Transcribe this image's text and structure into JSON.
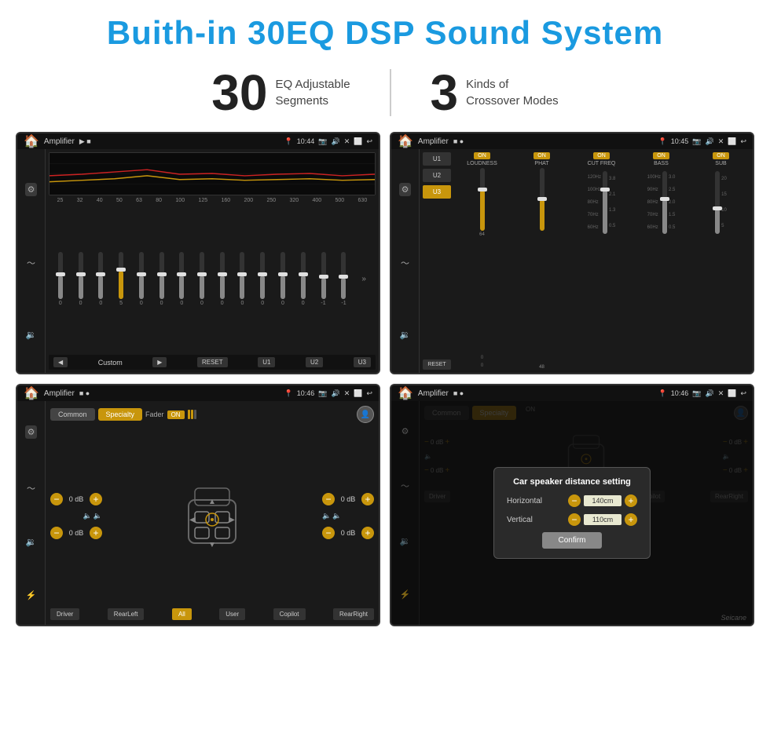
{
  "header": {
    "title": "Buith-in 30EQ DSP Sound System",
    "title_color": "#1a9ae0"
  },
  "stats": [
    {
      "number": "30",
      "label": "EQ Adjustable\nSegments"
    },
    {
      "number": "3",
      "label": "Kinds of\nCrossover Modes"
    }
  ],
  "screens": {
    "top_left": {
      "title": "Amplifier",
      "time": "10:44",
      "eq_labels": [
        "25",
        "32",
        "40",
        "50",
        "63",
        "80",
        "100",
        "125",
        "160",
        "200",
        "250",
        "320",
        "400",
        "500",
        "630"
      ],
      "eq_values": [
        "0",
        "0",
        "0",
        "5",
        "0",
        "0",
        "0",
        "0",
        "0",
        "0",
        "0",
        "0",
        "0",
        "-1",
        "0",
        "-1"
      ],
      "bottom_btns": [
        "Custom",
        "RESET",
        "U1",
        "U2",
        "U3"
      ]
    },
    "top_right": {
      "title": "Amplifier",
      "time": "10:45",
      "presets": [
        "U1",
        "U2",
        "U3"
      ],
      "channels": [
        "LOUDNESS",
        "PHAT",
        "CUT FREQ",
        "BASS",
        "SUB"
      ],
      "on_label": "ON",
      "reset_label": "RESET"
    },
    "bottom_left": {
      "title": "Amplifier",
      "time": "10:46",
      "mode_btns": [
        "Common",
        "Specialty"
      ],
      "active_mode": "Specialty",
      "fader_label": "Fader",
      "on_label": "ON",
      "db_values": [
        "0 dB",
        "0 dB",
        "0 dB",
        "0 dB"
      ],
      "speaker_btns": [
        "Driver",
        "RearLeft",
        "All",
        "User",
        "Copilot",
        "RearRight"
      ]
    },
    "bottom_right": {
      "title": "Amplifier",
      "time": "10:46",
      "dialog": {
        "title": "Car speaker distance setting",
        "horizontal_label": "Horizontal",
        "horizontal_value": "140cm",
        "vertical_label": "Vertical",
        "vertical_value": "110cm",
        "confirm_label": "Confirm"
      },
      "db_values": [
        "0 dB",
        "0 dB"
      ]
    }
  },
  "watermark": "Seicane"
}
